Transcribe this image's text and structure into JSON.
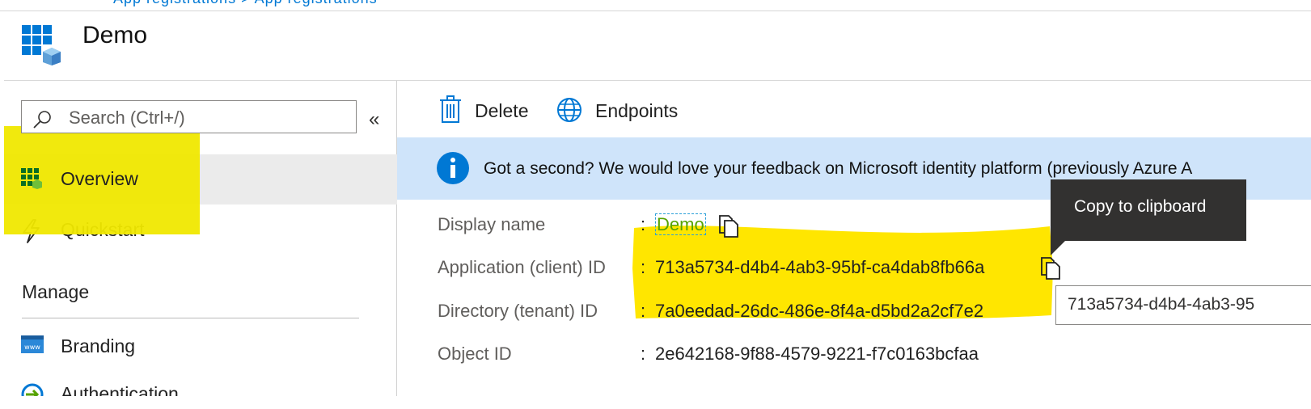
{
  "breadcrumb_partial": "App registrations > App registrations",
  "header": {
    "title": "Demo"
  },
  "sidebar": {
    "search_placeholder": "Search (Ctrl+/)",
    "collapse_glyph": "«",
    "items": [
      {
        "label": "Overview",
        "icon": "overview-grid-icon",
        "selected": true
      },
      {
        "label": "Quickstart",
        "icon": "lightning-icon"
      }
    ],
    "section": "Manage",
    "manage_items": [
      {
        "label": "Branding",
        "icon": "branding-www-icon"
      },
      {
        "label": "Authentication",
        "icon": "authentication-icon"
      }
    ]
  },
  "commands": {
    "delete_label": "Delete",
    "endpoints_label": "Endpoints"
  },
  "banner": {
    "text": "Got a second? We would love your feedback on Microsoft identity platform (previously Azure A"
  },
  "properties": [
    {
      "label": "Display name",
      "value": "Demo"
    },
    {
      "label": "Application (client) ID",
      "value": "713a5734-d4b4-4ab3-95bf-ca4dab8fb66a"
    },
    {
      "label": "Directory (tenant) ID",
      "value": "7a0eedad-26dc-486e-8f4a-d5bd2a2cf7e2"
    },
    {
      "label": "Object ID",
      "value": "2e642168-9f88-4579-9221-f7c0163bcfaa"
    }
  ],
  "colon": ":",
  "tooltip": {
    "text": "Copy to clipboard"
  },
  "copy_field": {
    "value": "713a5734-d4b4-4ab3-95"
  },
  "colors": {
    "accent": "#0078d4",
    "highlight": "#ffe600",
    "banner": "#cfe4fa",
    "tooltip": "#323130"
  }
}
